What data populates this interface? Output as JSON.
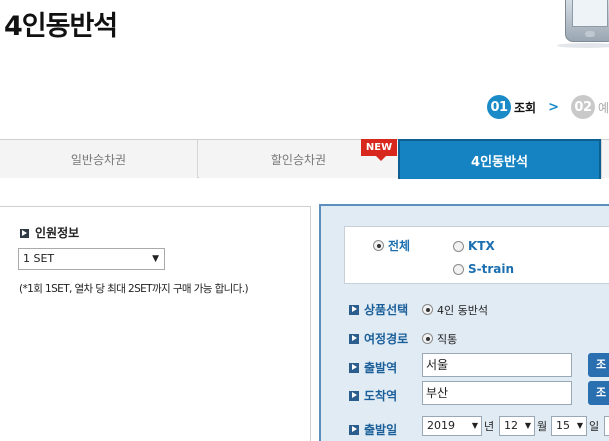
{
  "page": {
    "title": "4인동반석"
  },
  "steps": [
    {
      "num": "01",
      "label": "조회",
      "state": "active"
    },
    {
      "num": "02",
      "label": "예",
      "state": "inactive"
    }
  ],
  "tabs": [
    {
      "label": "일반승차권",
      "selected": false
    },
    {
      "label": "할인승차권",
      "selected": false,
      "badge": "NEW"
    },
    {
      "label": "4인동반석",
      "selected": true
    }
  ],
  "person": {
    "heading": "인원정보",
    "set_value": "1 SET",
    "note": "(*1회 1SET, 열차 당 최대 2SET까지 구매 가능 합니다.)"
  },
  "train_types": [
    {
      "label": "전체",
      "checked": true
    },
    {
      "label": "KTX",
      "checked": false
    },
    {
      "label": "S-train",
      "checked": false
    }
  ],
  "form": {
    "product": {
      "label": "상품선택",
      "option": "4인 동반석",
      "checked": true
    },
    "route": {
      "label": "여정경로",
      "option": "직통",
      "checked": true
    },
    "departure": {
      "label": "출발역",
      "value": "서울",
      "button": "조"
    },
    "arrival": {
      "label": "도착역",
      "value": "부산",
      "button": "조"
    },
    "date": {
      "label": "출발일",
      "year": "2019",
      "year_unit": "년",
      "month": "12",
      "month_unit": "월",
      "day": "15",
      "day_unit": "일"
    }
  },
  "colors": {
    "accent": "#1583c2",
    "badge": "#d8271c",
    "panel_bg": "#e1ebf4",
    "label_blue": "#1b5f9a"
  }
}
